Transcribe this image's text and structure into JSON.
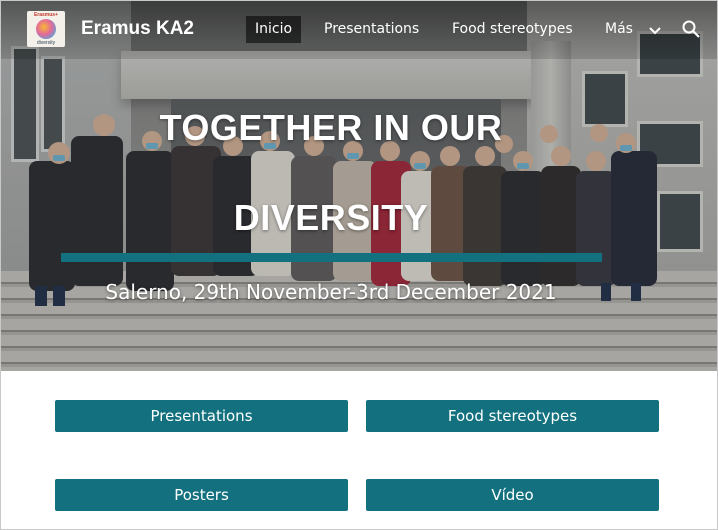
{
  "header": {
    "site_title": "Eramus KA2",
    "logo": {
      "icon": "project-logo-icon",
      "text_top": "Erasmus+",
      "text_bottom": "diversity"
    },
    "nav": [
      {
        "label": "Inicio",
        "active": true
      },
      {
        "label": "Presentations",
        "active": false
      },
      {
        "label": "Food stereotypes",
        "active": false
      },
      {
        "label": "Más",
        "active": false
      }
    ],
    "more_icon": "chevron-down-icon",
    "search_icon": "search-icon"
  },
  "hero": {
    "title_line1": "TOGETHER IN OUR",
    "title_line2": "DIVERSITY",
    "subtitle": "Salerno, 29th November-3rd December 2021",
    "accent_color": "#13717f"
  },
  "buttons": [
    {
      "label": "Presentations"
    },
    {
      "label": "Food stereotypes"
    },
    {
      "label": "Posters"
    },
    {
      "label": "Vídeo"
    }
  ],
  "colors": {
    "button_bg": "#13717f",
    "button_text": "#ffffff",
    "page_bg": "#ffffff"
  }
}
